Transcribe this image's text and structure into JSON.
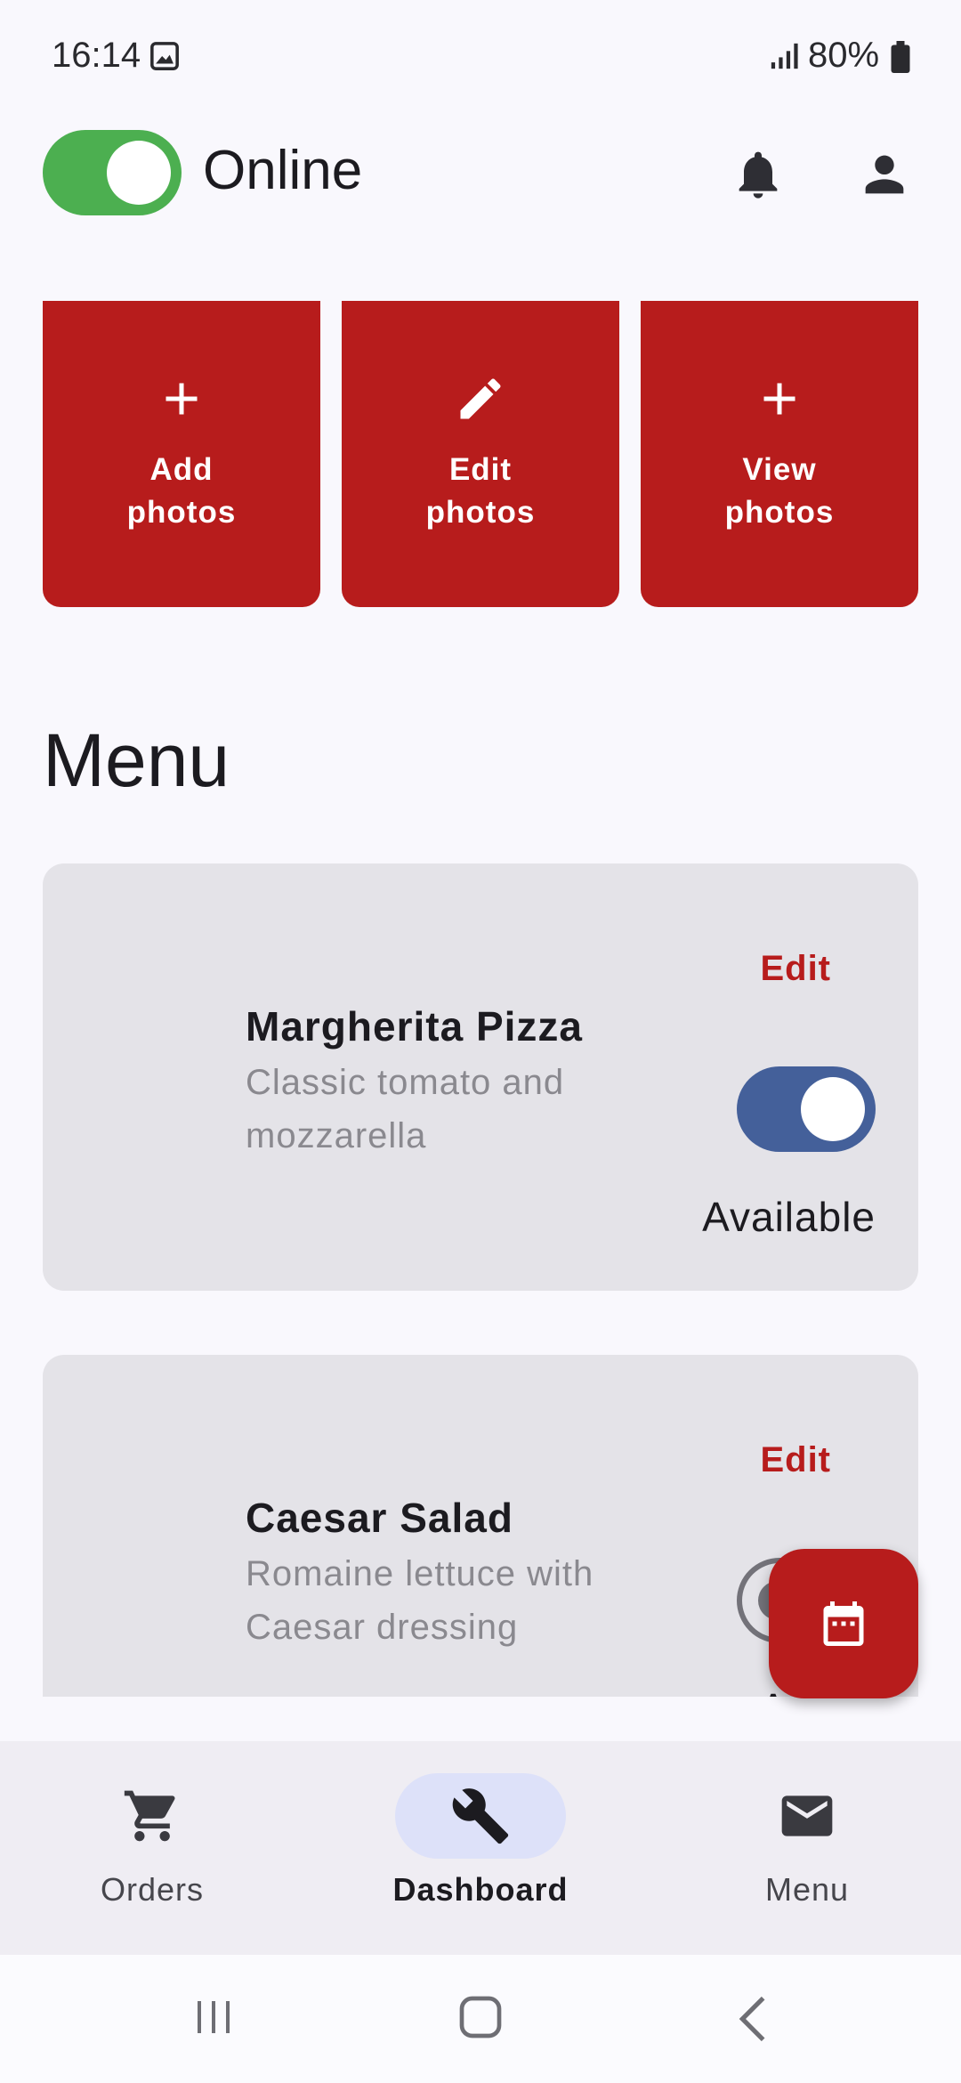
{
  "status_bar": {
    "time": "16:14",
    "battery": "80%",
    "icons": [
      "image-icon",
      "signal-icon",
      "battery-icon"
    ]
  },
  "header": {
    "online_label": "Online",
    "online_toggle_on": true,
    "icons": [
      "bell-icon",
      "person-icon"
    ]
  },
  "photo_actions": [
    {
      "label_line1": "Add",
      "label_line2": "photos",
      "icon": "plus-icon"
    },
    {
      "label_line1": "Edit",
      "label_line2": "photos",
      "icon": "pencil-icon"
    },
    {
      "label_line1": "View",
      "label_line2": "photos",
      "icon": "plus-icon"
    }
  ],
  "menu": {
    "heading": "Menu",
    "items": [
      {
        "name": "Margherita Pizza",
        "description_line1": "Classic tomato and",
        "description_line2": "mozzarella",
        "edit_label": "Edit",
        "available_label": "Available",
        "available": true
      },
      {
        "name": "Caesar Salad",
        "description_line1": "Romaine lettuce with",
        "description_line2": "Caesar dressing",
        "edit_label": "Edit",
        "available_label": "Availa",
        "available": false
      }
    ]
  },
  "fab": {
    "icon": "calendar-icon"
  },
  "bottom_nav": {
    "items": [
      {
        "label": "Orders",
        "icon": "cart-icon",
        "active": false
      },
      {
        "label": "Dashboard",
        "icon": "wrench-icon",
        "active": true
      },
      {
        "label": "Menu",
        "icon": "mail-icon",
        "active": false
      }
    ]
  },
  "colors": {
    "accent_red": "#b71c1c",
    "online_green": "#4caf50",
    "toggle_blue": "#44609a",
    "nav_active_pill": "#dde1f9",
    "background": "#f9f8fd",
    "card": "#e4e3e8"
  }
}
